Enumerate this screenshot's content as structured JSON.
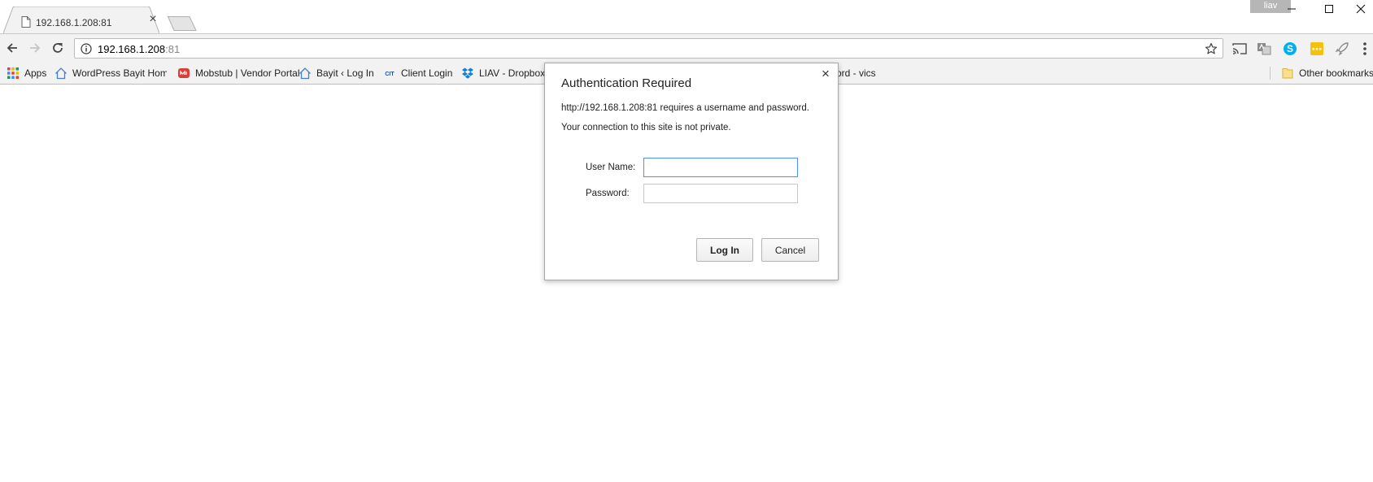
{
  "window": {
    "profile_name": "liav"
  },
  "tabs": [
    {
      "title": "192.168.1.208:81",
      "active": true
    }
  ],
  "address_bar": {
    "host": "192.168.1.208",
    "port": ":81"
  },
  "toolbar": {
    "extensions": [
      "cast-icon",
      "translate-icon",
      "skype-icon",
      "yellow-extension-icon",
      "rocket-icon"
    ]
  },
  "bookmarks": {
    "items": [
      {
        "label": "Apps",
        "icon": "apps-grid-icon"
      },
      {
        "label": "WordPress Bayit Home",
        "icon": "home-icon"
      },
      {
        "label": "Mobstub | Vendor Portal",
        "icon": "mobstub-icon"
      },
      {
        "label": "Bayit ‹ Log In",
        "icon": "home-icon"
      },
      {
        "label": "Client Login",
        "icon": "cit-icon"
      },
      {
        "label": "LIAV - Dropbox",
        "icon": "dropbox-icon"
      },
      {
        "label": "ord - vics",
        "icon": ""
      }
    ],
    "other_label": "Other bookmarks"
  },
  "dialog": {
    "title": "Authentication Required",
    "message": "http://192.168.1.208:81 requires a username and password.",
    "warning": "Your connection to this site is not private.",
    "username_label": "User Name:",
    "password_label": "Password:",
    "username_value": "",
    "password_value": "",
    "login_label": "Log In",
    "cancel_label": "Cancel"
  },
  "colors": {
    "toolbar_bg": "#f2f2f2",
    "focus_ring": "#4d90fe",
    "skype_blue": "#00aff0",
    "extension_yellow": "#f4c20d"
  }
}
